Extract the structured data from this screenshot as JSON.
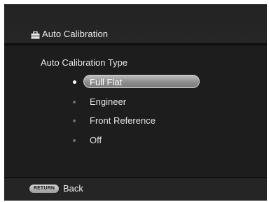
{
  "header": {
    "title": "Auto Calibration",
    "icon": "toolbox-icon"
  },
  "main": {
    "section_label": "Auto Calibration Type",
    "options": [
      {
        "label": "Full Flat",
        "selected": true
      },
      {
        "label": "Engineer",
        "selected": false
      },
      {
        "label": "Front Reference",
        "selected": false
      },
      {
        "label": "Off",
        "selected": false
      }
    ]
  },
  "footer": {
    "return_button_label": "RETURN",
    "back_label": "Back"
  },
  "colors": {
    "background": "#1b1b1b",
    "highlight": "#9e9e9e",
    "text": "#e6e6e6"
  }
}
